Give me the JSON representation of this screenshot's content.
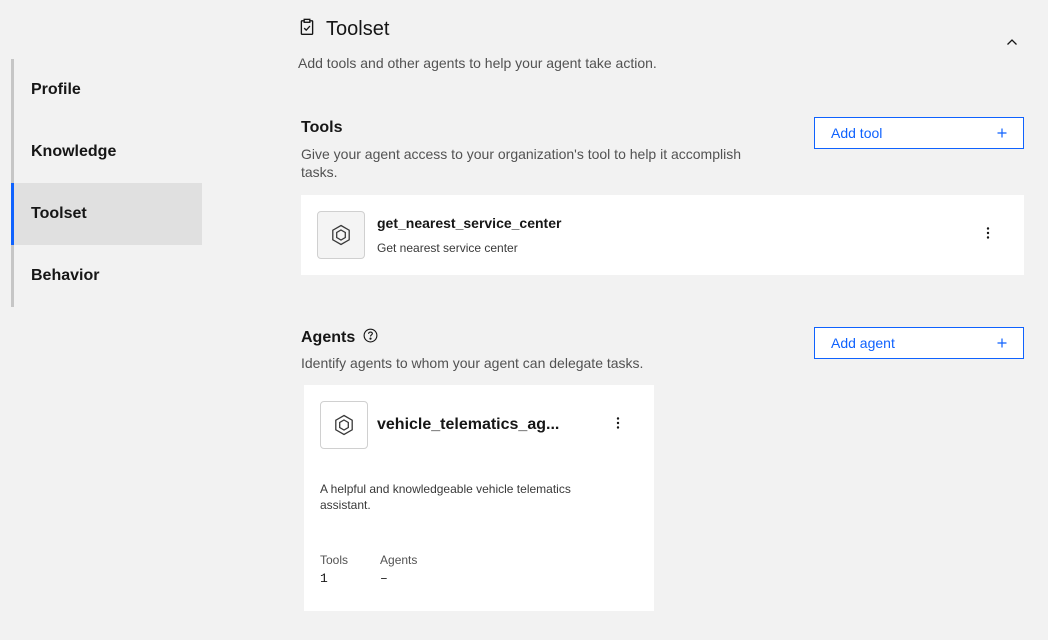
{
  "sidebar": {
    "items": [
      {
        "label": "Profile"
      },
      {
        "label": "Knowledge"
      },
      {
        "label": "Toolset"
      },
      {
        "label": "Behavior"
      }
    ],
    "active": "Toolset"
  },
  "section": {
    "title": "Toolset",
    "description": "Add tools and other agents to help your agent take action.",
    "icon": "clipboard-check-icon",
    "collapse_icon": "chevron-up-icon"
  },
  "tools": {
    "title": "Tools",
    "description": "Give your agent access to your organization's tool to help it accomplish tasks.",
    "add_label": "Add tool",
    "items": [
      {
        "name": "get_nearest_service_center",
        "description": "Get nearest service center",
        "icon": "tool-hexagon-icon"
      }
    ]
  },
  "agents": {
    "title": "Agents",
    "description": "Identify agents to whom your agent can delegate tasks.",
    "add_label": "Add agent",
    "help_icon": "help-circle-icon",
    "items": [
      {
        "name": "vehicle_telematics_ag...",
        "description": "A helpful and knowledgeable vehicle telematics assistant.",
        "tools_label": "Tools",
        "tools_value": "1",
        "agents_label": "Agents",
        "agents_value": "–",
        "icon": "agent-hexagon-icon"
      }
    ]
  },
  "colors": {
    "accent": "#0f62fe",
    "background": "#f2f2f2",
    "card": "#ffffff"
  }
}
